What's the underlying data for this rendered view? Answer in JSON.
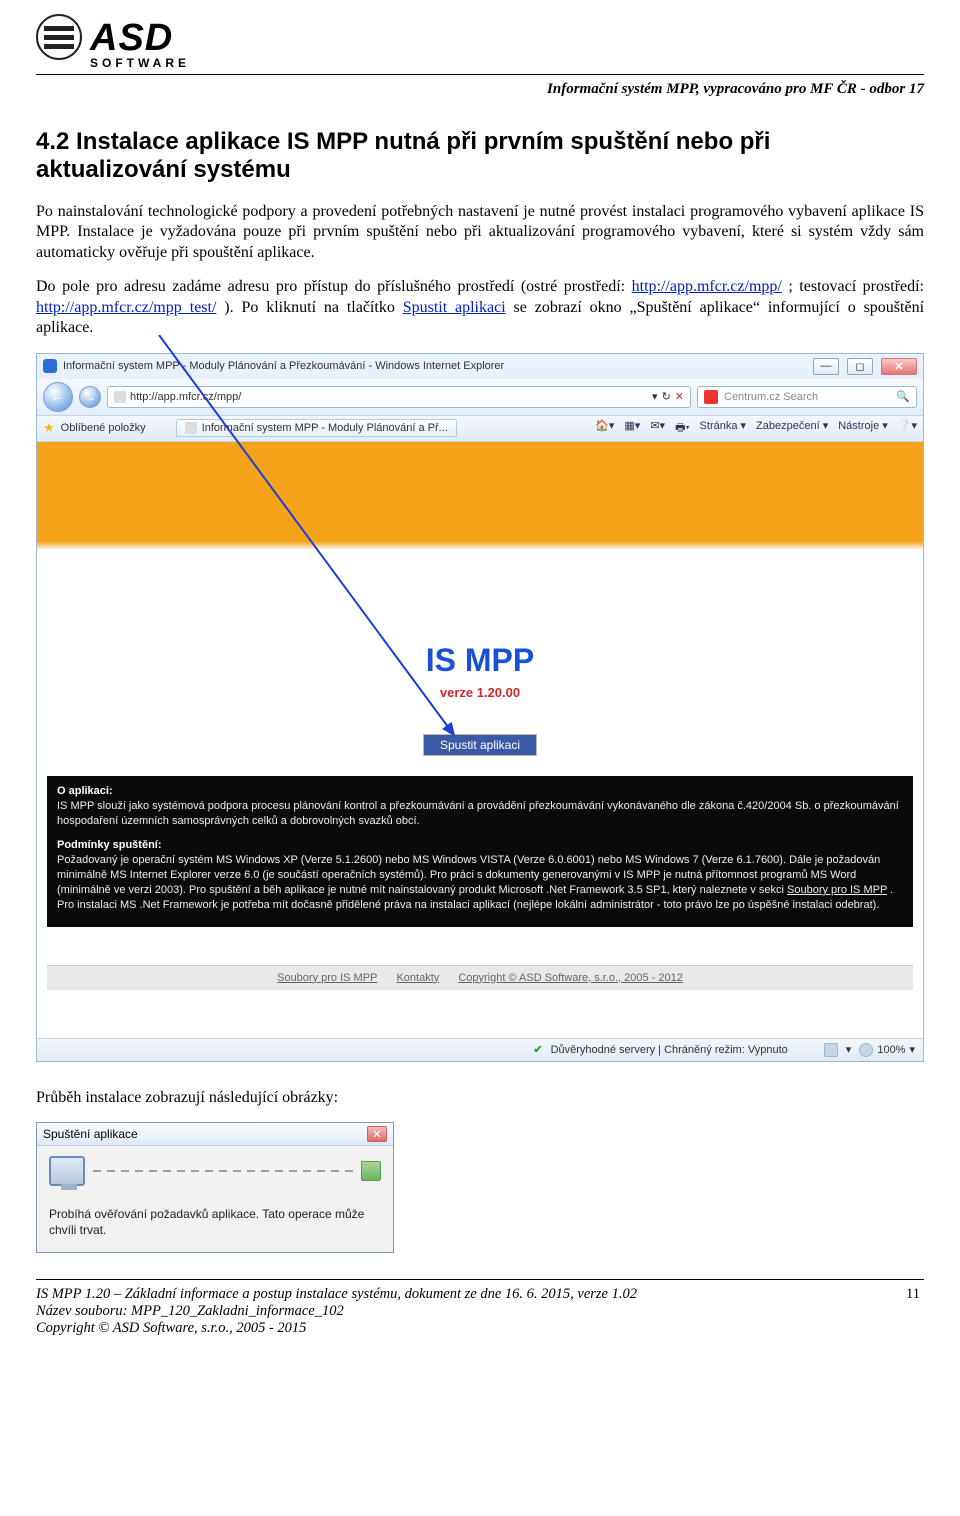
{
  "header": {
    "logo_main": "ASD",
    "logo_sub": "SOFTWARE",
    "note": "Informační systém MPP, vypracováno pro MF ČR - odbor 17"
  },
  "section": {
    "title": "4.2 Instalace aplikace IS MPP nutná při prvním spuštění nebo při aktualizování systému",
    "p1": "Po nainstalování technologické podpory a provedení potřebných nastavení je nutné provést instalaci programového vybavení aplikace IS MPP. Instalace je vyžadována pouze při prvním spuštění nebo při aktualizování programového vybavení, které si systém vždy sám automaticky ověřuje při spouštění aplikace.",
    "p2_a": "Do pole pro adresu zadáme adresu pro přístup do příslušného prostředí (ostré prostředí: ",
    "link1": "http://app.mfcr.cz/mpp/",
    "p2_b": " ; testovací prostředí: ",
    "link2": "http://app.mfcr.cz/mpp_test/",
    "p2_c": " ). Po kliknutí na tlačítko ",
    "link3": "Spustit aplikaci",
    "p2_d": " se zobrazí okno „Spuštění aplikace“ informující o spouštění aplikace.",
    "after_img": "Průběh instalace zobrazují následující obrázky:"
  },
  "ie": {
    "title": "Informační system MPP - Moduly Plánování a Přezkoumávání - Windows Internet Explorer",
    "url": "http://app.mfcr.cz/mpp/",
    "search_placeholder": "Centrum.cz Search",
    "fav_label": "Oblíbené položky",
    "tab_label": "Informační system MPP - Moduly Plánování a Př...",
    "tools": {
      "home": "Domů",
      "rss": "RSS",
      "mail": "E-mail",
      "print": "Tisk",
      "page": "Stránka ▾",
      "safety": "Zabezpečení ▾",
      "tools_label": "Nástroje ▾"
    },
    "page": {
      "title": "IS MPP",
      "version": "verze 1.20.00",
      "launch": "Spustit aplikaci",
      "about_h": "O aplikaci:",
      "about": "IS MPP slouží jako systémová podpora procesu plánování kontrol a přezkoumávání a provádění přezkoumávání vykonávaného dle zákona č.420/2004 Sb. o přezkoumávání hospodaření územních samosprávných celků a dobrovolných svazků obcí.",
      "cond_h": "Podmínky spuštění:",
      "cond": "Požadovaný je operační systém MS Windows XP (Verze 5.1.2600) nebo MS Windows VISTA (Verze 6.0.6001) nebo MS Windows 7 (Verze 6.1.7600). Dále je požadován minimálně MS Internet Explorer verze 6.0 (je součástí operačních systémů). Pro práci s dokumenty generovanými v IS MPP je nutná přítomnost programů MS Word (minimálně ve verzi 2003). Pro spuštění a běh aplikace je nutné mít nainstalovaný produkt Microsoft .Net Framework 3.5 SP1, který naleznete v sekci ",
      "cond_link": "Soubory pro IS MPP",
      "cond_tail": ". Pro instalaci MS .Net Framework je potřeba mít dočasně přidělené práva na instalaci aplikací (nejlépe lokální administrátor - toto právo lze po úspěšné instalaci odebrat).",
      "footer_links": [
        "Soubory pro IS MPP",
        "Kontakty",
        "Copyright © ASD Software, s.r.o., 2005 - 2012"
      ]
    },
    "status": {
      "zone": "Důvěryhodné servery | Chráněný režim: Vypnuto",
      "zoom": "100%"
    }
  },
  "dialog": {
    "title": "Spuštění aplikace",
    "text": "Probíhá ověřování požadavků aplikace. Tato operace může chvíli trvat."
  },
  "footer": {
    "l1": "IS MPP 1.20 – Základní informace a postup instalace systému, dokument ze dne 16. 6. 2015, verze 1.02",
    "l2": "Název souboru: MPP_120_Zakladni_informace_102",
    "l3": "Copyright © ASD Software, s.r.o., 2005 - 2015",
    "page": "11"
  }
}
